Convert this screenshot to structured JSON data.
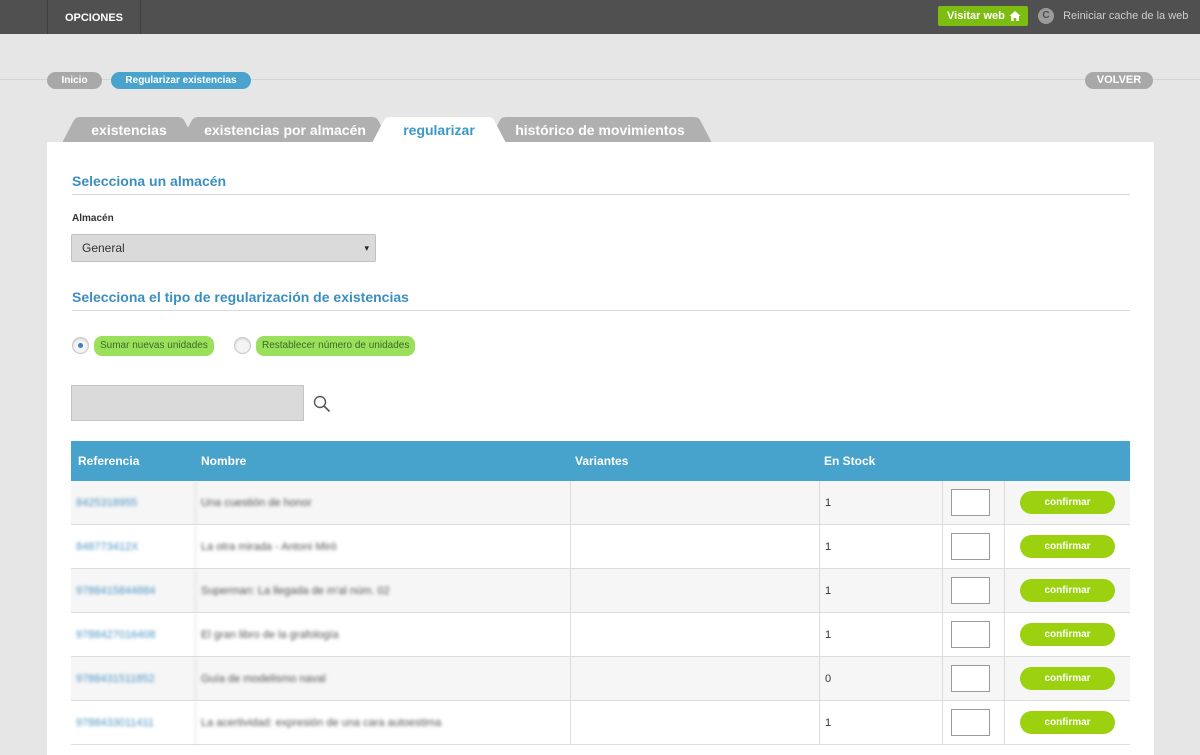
{
  "topbar": {
    "menu_label": "OPCIONES",
    "visit_label": "Visitar web",
    "visit_icon": "home-icon",
    "cache_icon_glyph": "C",
    "cache_label": "Reiniciar cache de la web"
  },
  "breadcrumb": {
    "home": "Inicio",
    "current": "Regularizar existencias",
    "back": "VOLVER"
  },
  "tabs": [
    {
      "label": "existencias",
      "active": false
    },
    {
      "label": "existencias por almacén",
      "active": false
    },
    {
      "label": "regularizar",
      "active": true
    },
    {
      "label": "histórico de movimientos",
      "active": false
    }
  ],
  "warehouse": {
    "section_title": "Selecciona un almacén",
    "field_label": "Almacén",
    "selected": "General",
    "chevron": "▾"
  },
  "regularization": {
    "section_title": "Selecciona el tipo de regularización de existencias",
    "options": [
      {
        "label": "Sumar nuevas unidades",
        "selected": true
      },
      {
        "label": "Restablecer número de unidades",
        "selected": false
      }
    ]
  },
  "search": {
    "value": "",
    "icon": "search-icon"
  },
  "table": {
    "headers": {
      "ref": "Referencia",
      "name": "Nombre",
      "variants": "Variantes",
      "stock": "En Stock"
    },
    "confirm_label": "confirmar",
    "rows": [
      {
        "ref": "8425318955",
        "name": "Una cuestión de honor",
        "variants": "",
        "stock": "1"
      },
      {
        "ref": "848773412X",
        "name": "La otra mirada - Antoni Miró",
        "variants": "",
        "stock": "1"
      },
      {
        "ref": "9788415844884",
        "name": "Superman: La llegada de m'al núm. 02",
        "variants": "",
        "stock": "1"
      },
      {
        "ref": "9788427016408",
        "name": "El gran libro de la grafología",
        "variants": "",
        "stock": "1"
      },
      {
        "ref": "9788431511852",
        "name": "Guía de modelismo naval",
        "variants": "",
        "stock": "0"
      },
      {
        "ref": "9788433011411",
        "name": "La acertividad: expresión de una cara autoestima",
        "variants": "",
        "stock": "1"
      }
    ]
  },
  "colors": {
    "accent": "#47a2cc",
    "visit_button": "#7dbd12",
    "confirm_button": "#9bd10e",
    "radio_highlight": "#9be05a",
    "topbar": "#505050"
  }
}
